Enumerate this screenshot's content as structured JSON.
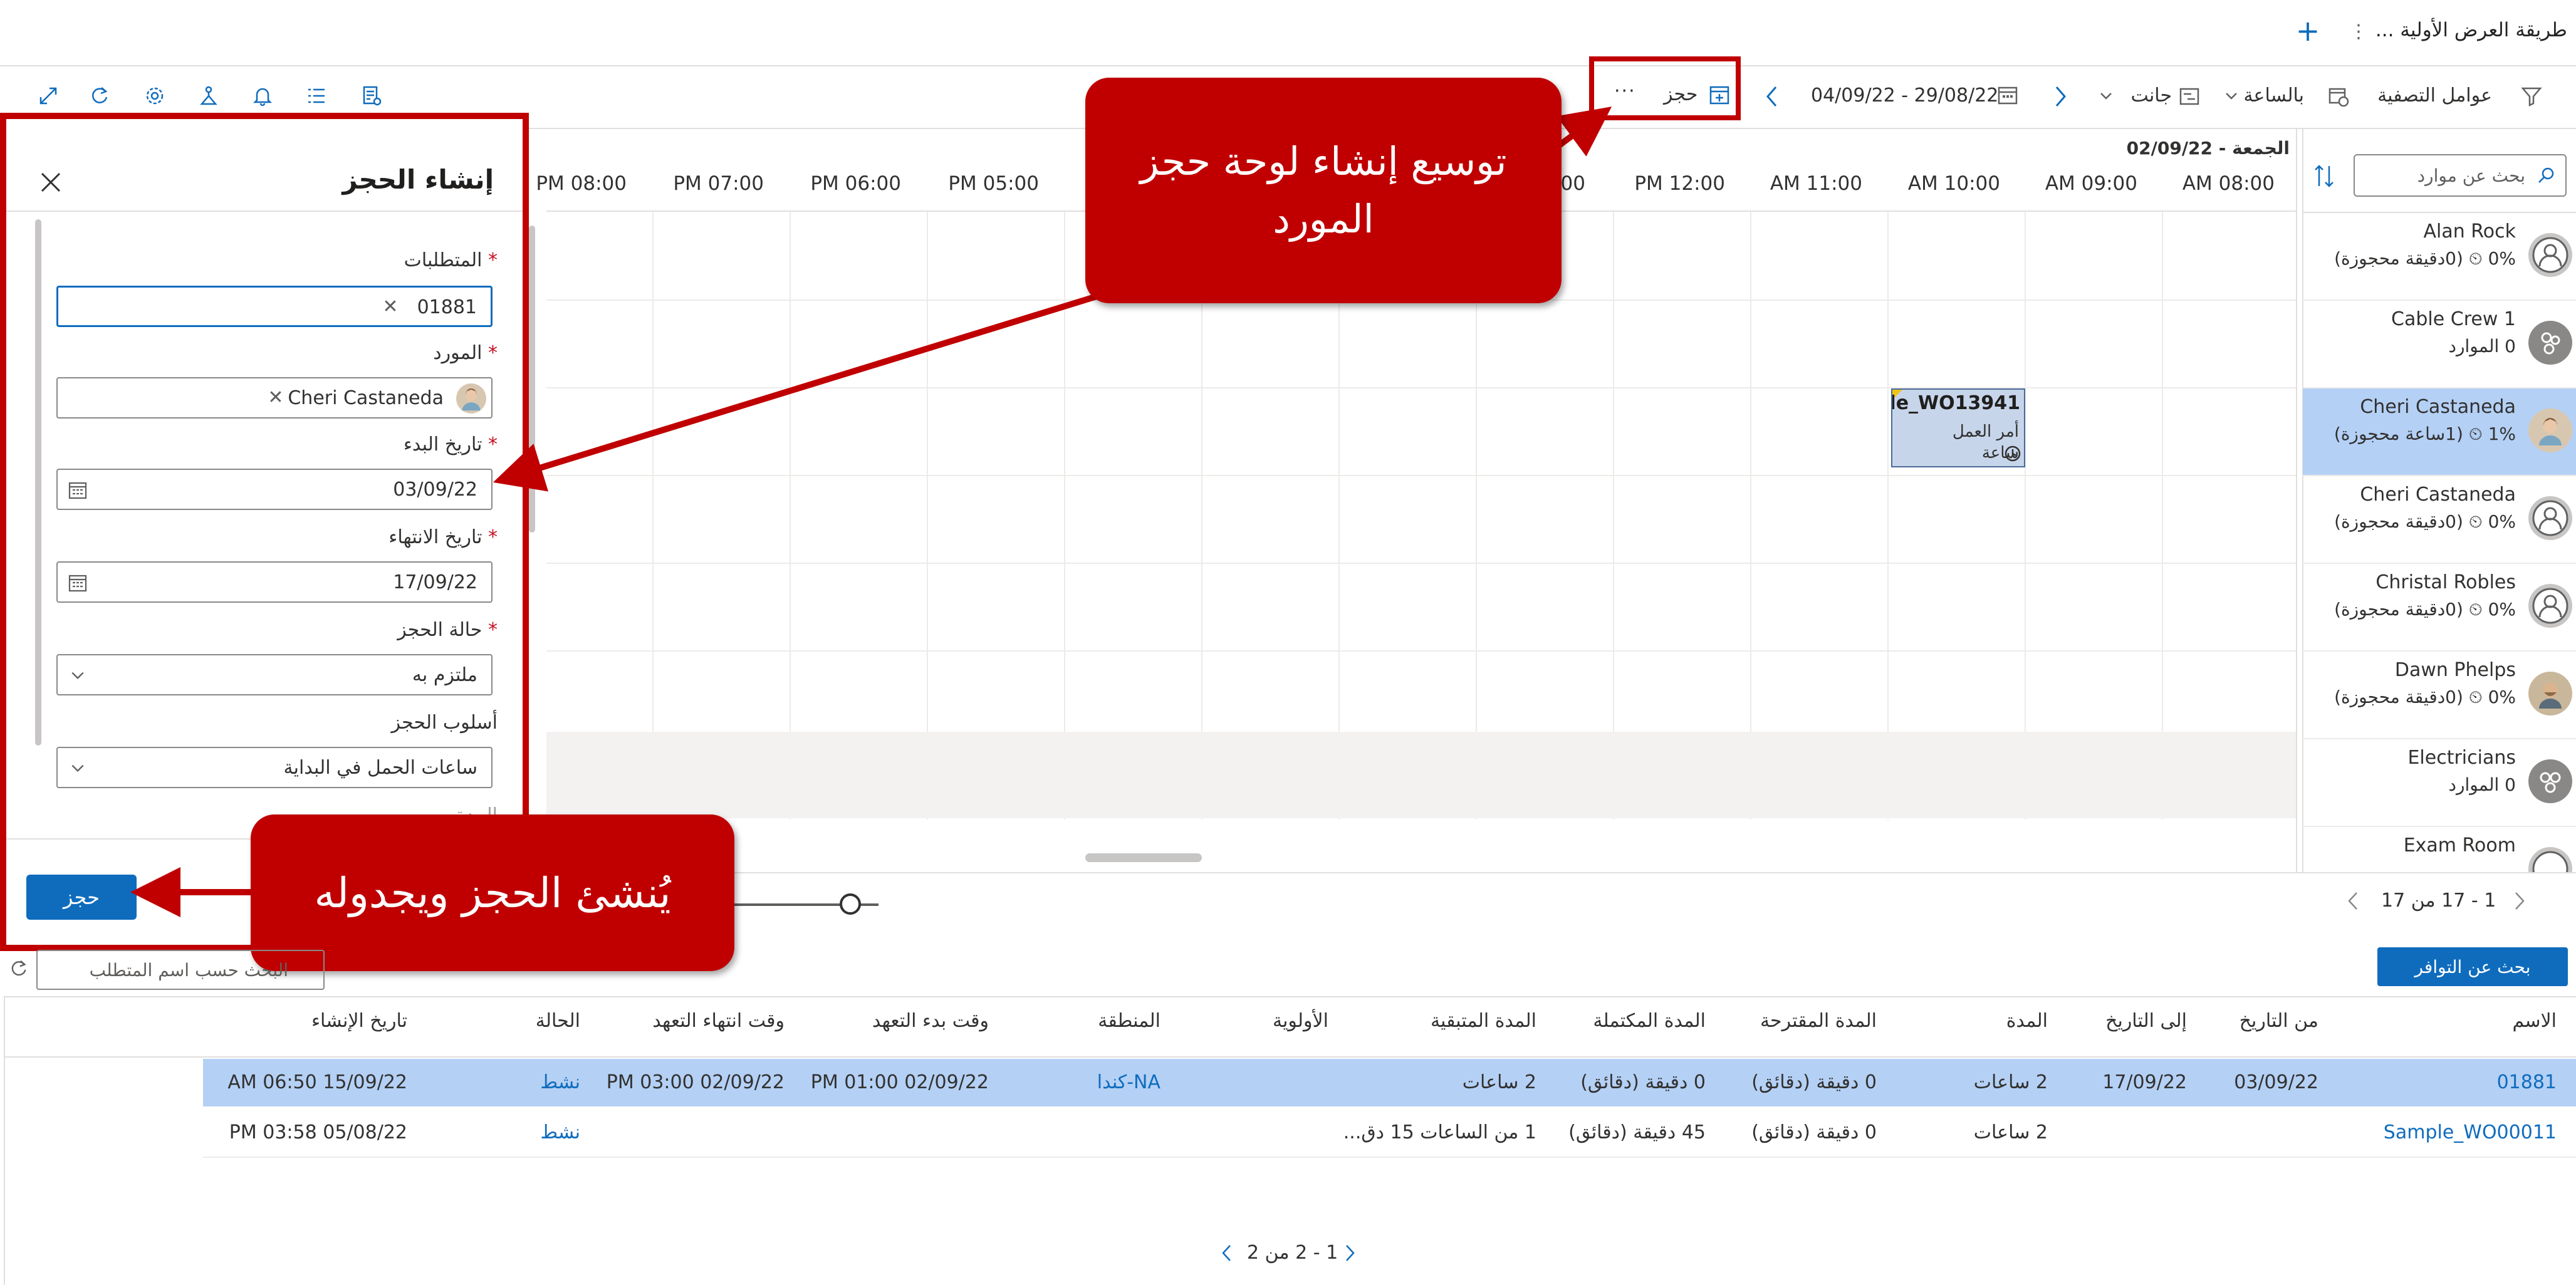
{
  "topbar": {
    "view_title": "طريقة العرض الأولية ...",
    "add_icon": "plus-icon",
    "more_icon": "vertical-ellipsis-icon"
  },
  "toolbar": {
    "filters_label": "عوامل التصفية",
    "hourly_label": "بالساعة",
    "gantt_label": "جانت",
    "date_range": "04/09/22 - 29/08/22",
    "book_label": "حجز",
    "more_label": "···",
    "left_icons": [
      "expand-icon",
      "refresh-icon",
      "gear-icon",
      "flask-icon",
      "bell-icon",
      "list-icon",
      "report-icon"
    ]
  },
  "schedule": {
    "day_label": "الجمعة - 02/09/22",
    "time_labels": [
      "AM 08:00",
      "AM 09:00",
      "AM 10:00",
      "AM 11:00",
      "PM 12:00",
      "00",
      "PM 05:00",
      "PM 06:00",
      "PM 07:00",
      "PM 08:00"
    ],
    "booking": {
      "title": "mple_WO13941",
      "line1": "أمر العمل",
      "line2": "ساعة"
    }
  },
  "resources": {
    "search_placeholder": "بحث عن موارد",
    "items": [
      {
        "name": "Alan Rock",
        "sub": "0%  ⏲ (0دقيقة محجوزة)",
        "avatar": "person-icon"
      },
      {
        "name": "Cable Crew 1",
        "sub": "0 الموارد",
        "avatar": "group-icon"
      },
      {
        "name": "Cheri Castaneda",
        "sub": "1%  ⏲ (1ساعة محجوزة)",
        "avatar": "photo-avatar"
      },
      {
        "name": "Cheri Castaneda",
        "sub": "0%  ⏲ (0دقيقة محجوزة)",
        "avatar": "person-icon"
      },
      {
        "name": "Christal Robles",
        "sub": "0%  ⏲ (0دقيقة محجوزة)",
        "avatar": "person-icon"
      },
      {
        "name": "Dawn Phelps",
        "sub": "0%  ⏲ (0دقيقة محجوزة)",
        "avatar": "photo-avatar"
      },
      {
        "name": "Electricians",
        "sub": "0 الموارد",
        "avatar": "group-icon"
      },
      {
        "name": "Exam Room",
        "sub": "",
        "avatar": "person-icon"
      }
    ],
    "pager": "1 - 17 من 17"
  },
  "form": {
    "title": "إنشاء الحجز",
    "requirement_label": "المتطلبات",
    "requirement_value": "01881",
    "resource_label": "المورد",
    "resource_value": "Cheri Castaneda",
    "start_label": "تاريخ البدء",
    "start_value": "03/09/22",
    "end_label": "تاريخ الانتهاء",
    "end_value": "17/09/22",
    "status_label": "حالة الحجز",
    "status_value": "ملتزم به",
    "method_label": "أسلوب الحجز",
    "method_value": "ساعات الحمل في البداية",
    "partial_label": "المدة",
    "book_button": "حجز"
  },
  "callouts": {
    "top": "توسيع إنشاء لوحة حجز المورد",
    "bottom": "يُنشئ الحجز ويجدوله"
  },
  "grid": {
    "availability_button": "بحث عن التوافر",
    "search_placeholder": "البحث حسب اسم المتطلب",
    "headers": [
      "الاسم",
      "من التاريخ",
      "إلى التاريخ",
      "المدة",
      "المدة المقترحة",
      "المدة المكتملة",
      "المدة المتبقية",
      "الأولوية",
      "المنطقة",
      "وقت بدء التعهد",
      "وقت انتهاء التعهد",
      "الحالة",
      "تاريخ الإنشاء"
    ],
    "rows": [
      [
        "01881",
        "03/09/22",
        "17/09/22",
        "2 ساعات",
        "0 دقيقة (دقائق)",
        "0 دقيقة (دقائق)",
        "2 ساعات",
        "",
        "NA-كندا",
        "PM 01:00 02/09/22",
        "PM 03:00 02/09/22",
        "نشط",
        "AM 06:50 15/09/22"
      ],
      [
        "Sample_WO00011",
        "",
        "",
        "2 ساعات",
        "0 دقيقة (دقائق)",
        "45 دقيقة (دقائق)",
        "1 من الساعات 15 دق...",
        "",
        "",
        "",
        "",
        "نشط",
        "PM 03:58 05/08/22"
      ]
    ],
    "pager": "1 - 2 من 2"
  },
  "colors": {
    "accent": "#0f6cbd",
    "callout": "#c00000",
    "selected_row": "#b4d0f5"
  }
}
